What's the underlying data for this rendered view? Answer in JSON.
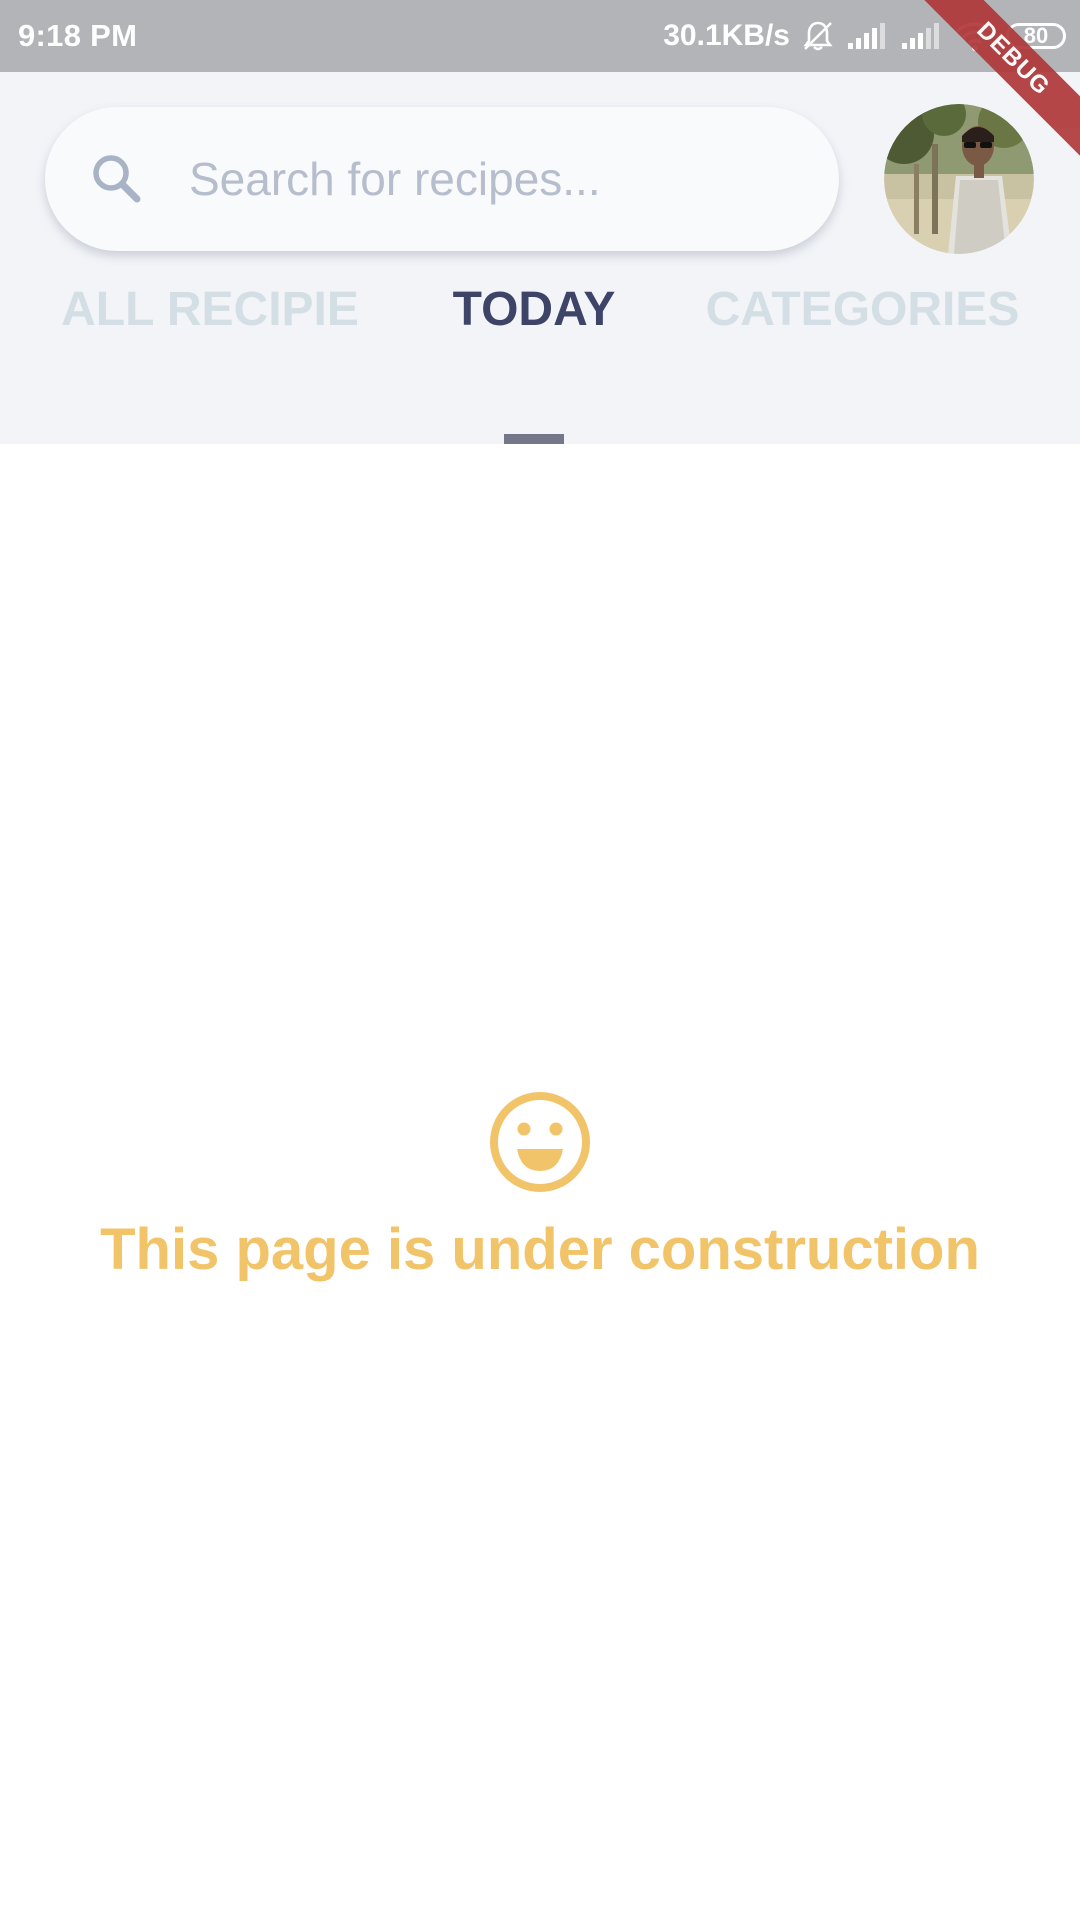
{
  "status_bar": {
    "time": "9:18 PM",
    "net_speed": "30.1KB/s",
    "battery": "80",
    "icons": [
      "bell-muted-icon",
      "signal-icon",
      "signal-icon",
      "wifi-icon",
      "battery-icon"
    ]
  },
  "debug_banner": "DEBUG",
  "search": {
    "placeholder": "Search for recipes...",
    "value": ""
  },
  "avatar": {
    "icon": "profile-avatar"
  },
  "tabs": {
    "items": [
      {
        "label": "ALL RECIPIE"
      },
      {
        "label": "TODAY"
      },
      {
        "label": "CATEGORIES"
      }
    ],
    "selected": "TODAY"
  },
  "content": {
    "icon": "smile-icon",
    "message": "This page is under construction"
  },
  "colors": {
    "status_bar": "#b3b4b8",
    "header_bg": "#f2f4f8",
    "active_tab": "#3d4468",
    "inactive_tab": "#d3dee5",
    "accent_yellow": "#f2c46a",
    "debug_ribbon": "#b0383a"
  }
}
